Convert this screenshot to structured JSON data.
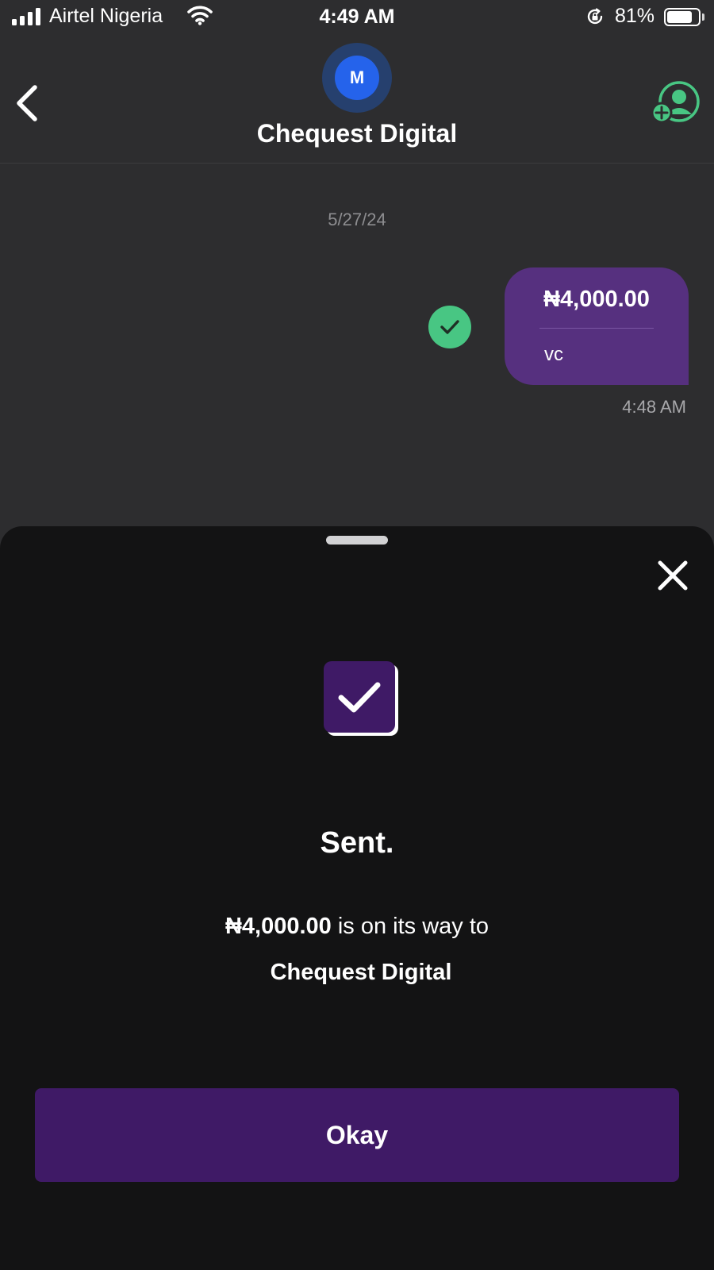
{
  "status_bar": {
    "carrier": "Airtel Nigeria",
    "time": "4:49 AM",
    "battery_percent": "81%",
    "battery_level": 0.81,
    "signal_icon": "signal-bars-icon",
    "wifi_icon": "wifi-icon",
    "rotation_lock_icon": "rotation-lock-icon"
  },
  "header": {
    "avatar_initial": "M",
    "title": "Chequest Digital",
    "back_icon": "chevron-left-icon",
    "add_contact_icon": "add-user-icon"
  },
  "conversation": {
    "date": "5/27/24",
    "message": {
      "amount": "₦4,000.00",
      "note": "vc",
      "time": "4:48 AM",
      "status_icon": "check-circle-icon"
    }
  },
  "sheet": {
    "close_icon": "close-icon",
    "success_icon": "checkbox-check-icon",
    "title": "Sent.",
    "amount": "₦4,000.00",
    "message_suffix": " is on its way to",
    "recipient": "Chequest Digital",
    "button_label": "Okay"
  },
  "colors": {
    "background": "#2d2d2f",
    "sheet": "#131314",
    "bubble": "#56307f",
    "button": "#3f1a66",
    "success_green": "#48c683",
    "avatar_blue": "#2563eb"
  }
}
